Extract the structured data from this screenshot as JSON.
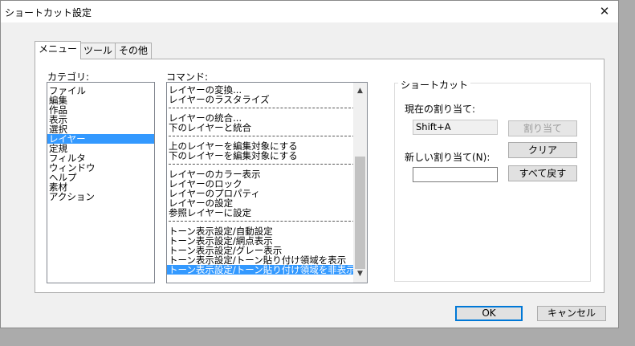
{
  "window": {
    "title": "ショートカット設定",
    "close_glyph": "✕"
  },
  "tabs": [
    {
      "label": "メニュー"
    },
    {
      "label": "ツール"
    },
    {
      "label": "その他"
    }
  ],
  "category": {
    "label": "カテゴリ:",
    "items": [
      "ファイル",
      "編集",
      "作品",
      "表示",
      "選択",
      "レイヤー",
      "定規",
      "フィルタ",
      "ウィンドウ",
      "ヘルプ",
      "素材",
      "アクション"
    ],
    "selected_index": 5
  },
  "command": {
    "label": "コマンド:",
    "groups": [
      [
        "レイヤーの変換...",
        "レイヤーのラスタライズ"
      ],
      [
        "レイヤーの統合...",
        "下のレイヤーと統合"
      ],
      [
        "上のレイヤーを編集対象にする",
        "下のレイヤーを編集対象にする"
      ],
      [
        "レイヤーのカラー表示",
        "レイヤーのロック",
        "レイヤーのプロパティ",
        "レイヤーの設定",
        "参照レイヤーに設定"
      ],
      [
        "トーン表示設定/自動設定",
        "トーン表示設定/網点表示",
        "トーン表示設定/グレー表示",
        "トーン表示設定/トーン貼り付け領域を表示",
        "トーン表示設定/トーン貼り付け領域を非表示"
      ]
    ],
    "selected": "トーン表示設定/トーン貼り付け領域を非表示",
    "scroll_up_glyph": "▲",
    "scroll_down_glyph": "▼",
    "scroll_position": 1.0
  },
  "shortcut": {
    "group_label": "ショートカット",
    "current_label": "現在の割り当て:",
    "current_value": "Shift+A",
    "new_label": "新しい割り当て(N):",
    "new_value": "",
    "assign_button": "割り当て",
    "clear_button": "クリア",
    "restore_all_button": "すべて戻す"
  },
  "footer": {
    "ok_button": "OK",
    "cancel_button": "キャンセル"
  }
}
